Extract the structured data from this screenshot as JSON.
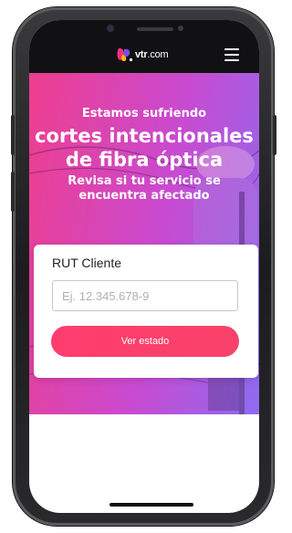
{
  "header": {
    "logo_text_bold": "vtr",
    "logo_text_light": ".com",
    "menu_icon": "hamburger-icon"
  },
  "hero": {
    "line1": "Estamos sufriendo",
    "line2a": "cortes intencionales",
    "line2b": "de fibra óptica",
    "line3a": "Revisa si tu servicio se",
    "line3b": "encuentra afectado"
  },
  "form": {
    "rut_label": "RUT Cliente",
    "rut_placeholder": "Ej. 12.345.678-9",
    "rut_value": "",
    "submit_label": "Ver estado"
  },
  "colors": {
    "hero_gradient_start": "#ee3e8e",
    "hero_gradient_mid": "#c94ad0",
    "hero_gradient_end": "#8e6bf0",
    "button": "#ff3d6e",
    "header_bg": "#111113"
  }
}
